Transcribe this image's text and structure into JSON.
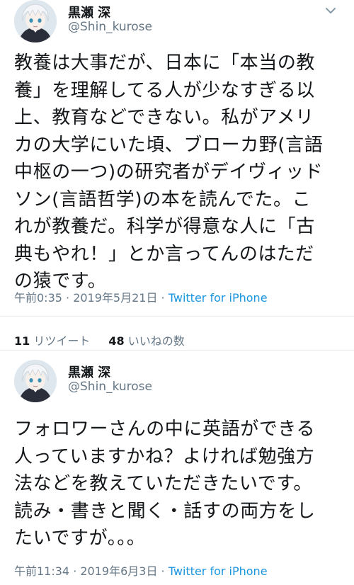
{
  "tweets": [
    {
      "author_name": "黒瀬 深",
      "author_handle": "@Shin_kurose",
      "text": "教養は大事だが、日本に「本当の教\n養」を理解してる人が少なすぎる以\n上、教育などできない。私がアメリ\nカの大学にいた頃、ブローカ野(言語\n中枢の一つ)の研究者がデイヴィッド\nソン(言語哲学)の本を読んでた。こ\nれが教養だ。科学が得意な人に「古\n典もやれ！」とか言ってんのはただ\nの猿です。",
      "timestamp": "午前0:35 · 2019年5月21日",
      "separator": "·",
      "source": "Twitter for iPhone",
      "retweets_count": "11",
      "retweets_label": "リツイート",
      "likes_count": "48",
      "likes_label": "いいねの数"
    },
    {
      "author_name": "黒瀬 深",
      "author_handle": "@Shin_kurose",
      "text": "フォロワーさんの中に英語ができる\n人っていますかね？よければ勉強方\n法などを教えていただきたいです。\n読み・書きと聞く・話すの両方をし\nたいですが。。。",
      "timestamp": "午前11:34 · 2019年6月3日",
      "separator": "·",
      "source": "Twitter for iPhone"
    }
  ],
  "icons": {
    "chevron": "chevron-down-icon",
    "avatar": "anime-character-avatar"
  },
  "colors": {
    "text": "#14171a",
    "secondary": "#657786",
    "link": "#1b95e0",
    "divider": "#e6ecf0"
  }
}
